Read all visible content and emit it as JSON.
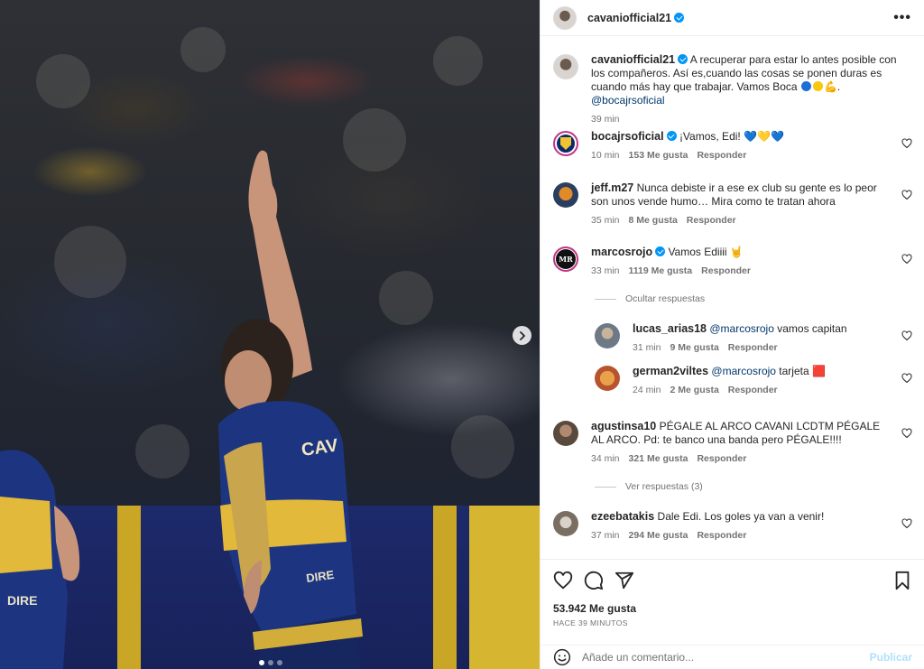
{
  "photo": {
    "carousel_dots": 3,
    "active_dot": 1,
    "next_icon": "chevron-right-icon"
  },
  "header": {
    "username": "cavaniofficial21",
    "more_icon": "more-horizontal-icon"
  },
  "caption": {
    "username": "cavaniofficial21",
    "text_before": "A recuperar para estar lo antes posible con los compañeros. Así es,cuando las cosas se ponen duras es cuando más hay que trabajar. Vamos Boca",
    "emojis": "🔵🟡💪",
    "mention": "@bocajrsoficial",
    "time": "39 min"
  },
  "comments": [
    {
      "username": "bocajrsoficial",
      "verified": true,
      "text": "¡Vamos, Edi! 💙💛💙",
      "time": "10 min",
      "likes": "153 Me gusta",
      "reply": "Responder"
    },
    {
      "username": "jeff.m27",
      "verified": false,
      "text": "Nunca debiste ir a ese ex club su gente es lo peor son unos vende humo… Mira como te tratan ahora",
      "time": "35 min",
      "likes": "8 Me gusta",
      "reply": "Responder"
    },
    {
      "username": "marcosrojo",
      "verified": true,
      "text": "Vamos Ediiii 🤘",
      "time": "33 min",
      "likes": "1119 Me gusta",
      "reply": "Responder"
    },
    {
      "username": "agustinsa10",
      "verified": false,
      "text": "PÉGALE AL ARCO CAVANI LCDTM PÉGALE AL ARCO. Pd: te banco una banda pero PÉGALE!!!!",
      "time": "34 min",
      "likes": "321 Me gusta",
      "reply": "Responder"
    },
    {
      "username": "ezeebatakis",
      "verified": false,
      "text": "Dale Edi. Los goles ya van a venir!",
      "time": "37 min",
      "likes": "294 Me gusta",
      "reply": "Responder"
    }
  ],
  "replies": [
    {
      "username": "lucas_arias18",
      "mention": "@marcosrojo",
      "text": "vamos capitan",
      "time": "31 min",
      "likes": "9 Me gusta",
      "reply": "Responder"
    },
    {
      "username": "german2viltes",
      "mention": "@marcosrojo",
      "text": "tarjeta 🟥",
      "time": "24 min",
      "likes": "2 Me gusta",
      "reply": "Responder"
    }
  ],
  "rojo_avatar_text": "MR",
  "hide_replies": "Ocultar respuestas",
  "view_replies": "Ver respuestas (3)",
  "actions": {
    "likes": "53.942 Me gusta",
    "ago": "HACE 39 MINUTOS",
    "icons": [
      "heart-icon",
      "comment-icon",
      "share-icon",
      "bookmark-icon"
    ]
  },
  "composer": {
    "placeholder": "Añade un comentario...",
    "publish": "Publicar",
    "emoji_icon": "smiley-icon"
  },
  "colors": {
    "verified": "#0095f6",
    "link": "#00376b",
    "muted": "#737373",
    "publish_disabled": "#b2dffc"
  }
}
